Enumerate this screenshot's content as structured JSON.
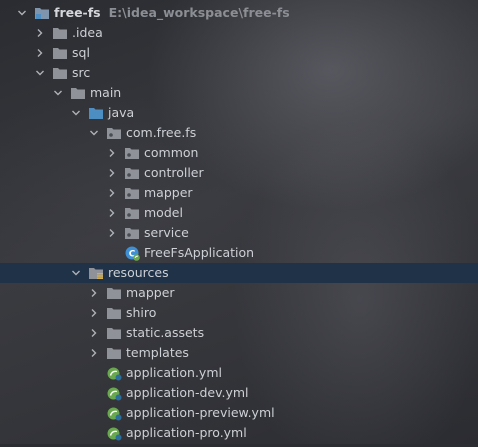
{
  "project_tree": {
    "root": {
      "name": "free-fs",
      "path": "E:\\idea_workspace\\free-fs"
    },
    "items": [
      {
        "label": "free-fs",
        "level": 0,
        "expanded": true,
        "type": "module"
      },
      {
        "label": ".idea",
        "level": 1,
        "expanded": false,
        "type": "folder"
      },
      {
        "label": "sql",
        "level": 1,
        "expanded": false,
        "type": "folder"
      },
      {
        "label": "src",
        "level": 1,
        "expanded": true,
        "type": "folder"
      },
      {
        "label": "main",
        "level": 2,
        "expanded": true,
        "type": "folder"
      },
      {
        "label": "java",
        "level": 3,
        "expanded": true,
        "type": "source-folder"
      },
      {
        "label": "com.free.fs",
        "level": 4,
        "expanded": true,
        "type": "package"
      },
      {
        "label": "common",
        "level": 5,
        "expanded": false,
        "type": "package"
      },
      {
        "label": "controller",
        "level": 5,
        "expanded": false,
        "type": "package"
      },
      {
        "label": "mapper",
        "level": 5,
        "expanded": false,
        "type": "package"
      },
      {
        "label": "model",
        "level": 5,
        "expanded": false,
        "type": "package"
      },
      {
        "label": "service",
        "level": 5,
        "expanded": false,
        "type": "package"
      },
      {
        "label": "FreeFsApplication",
        "level": 5,
        "type": "spring-class"
      },
      {
        "label": "resources",
        "level": 3,
        "expanded": true,
        "type": "resources-folder",
        "selected": true
      },
      {
        "label": "mapper",
        "level": 4,
        "expanded": false,
        "type": "folder"
      },
      {
        "label": "shiro",
        "level": 4,
        "expanded": false,
        "type": "folder"
      },
      {
        "label": "static.assets",
        "level": 4,
        "expanded": false,
        "type": "folder"
      },
      {
        "label": "templates",
        "level": 4,
        "expanded": false,
        "type": "folder"
      },
      {
        "label": "application.yml",
        "level": 4,
        "type": "yml"
      },
      {
        "label": "application-dev.yml",
        "level": 4,
        "type": "yml"
      },
      {
        "label": "application-preview.yml",
        "level": 4,
        "type": "yml"
      },
      {
        "label": "application-pro.yml",
        "level": 4,
        "type": "yml"
      }
    ]
  },
  "colors": {
    "selection": "#1f3247",
    "folder": "#8f9399",
    "package": "#8f9399",
    "source_folder": "#4e8ec2",
    "spring_icon": "#3f8fd4",
    "yml_icon": "#6aa84f"
  }
}
